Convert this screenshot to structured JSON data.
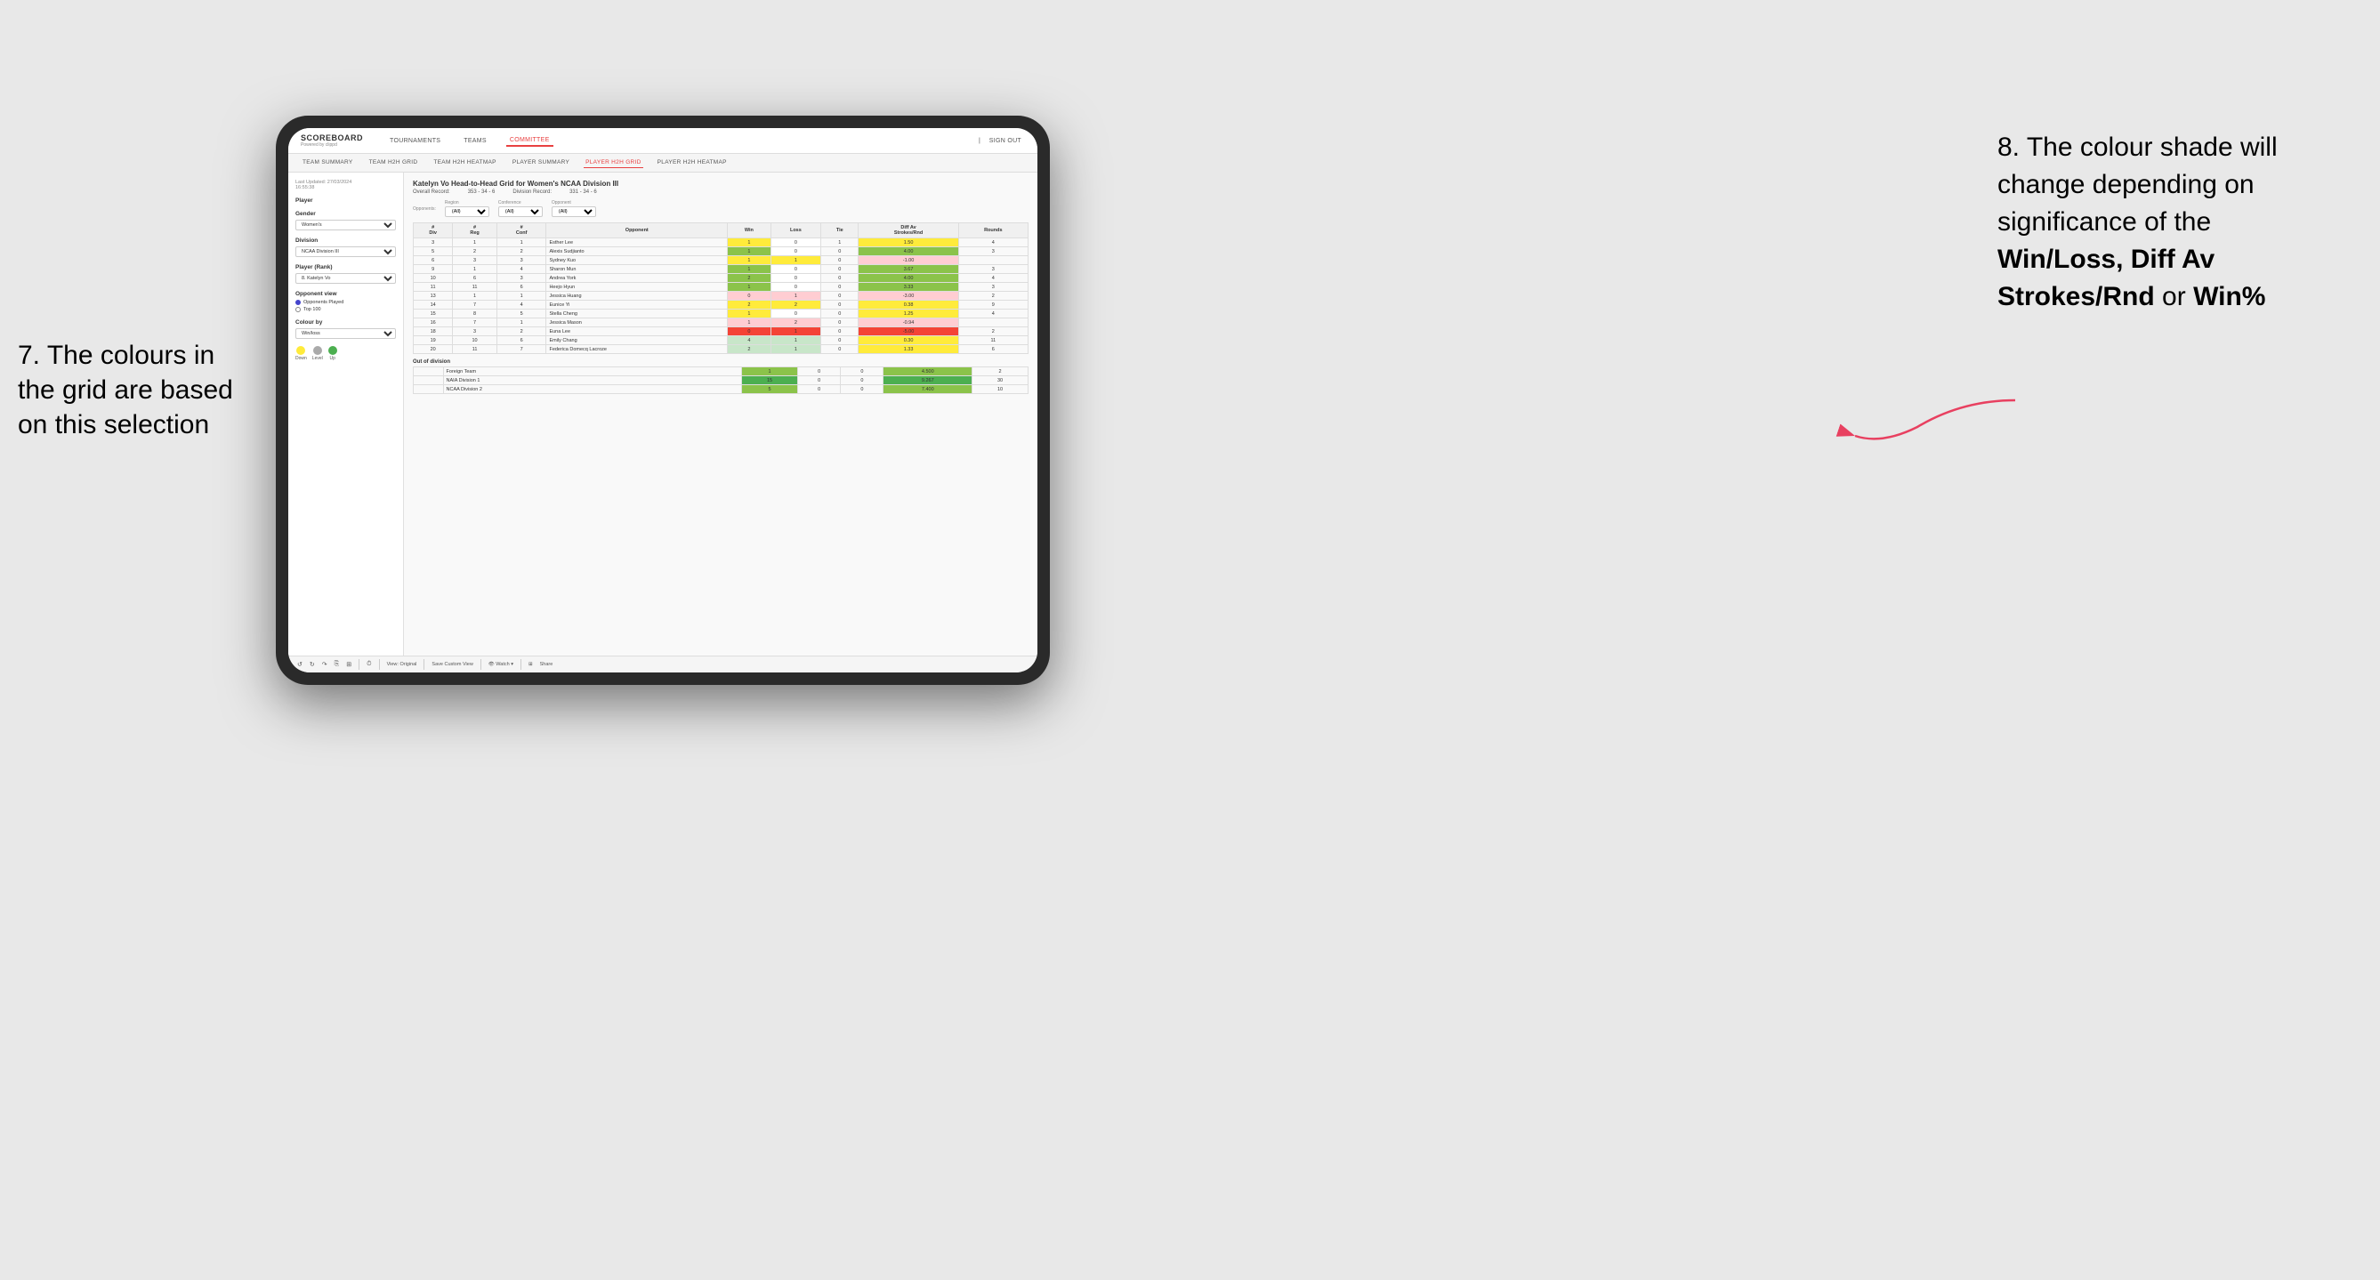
{
  "annotations": {
    "left_title": "7. The colours in the grid are based on this selection",
    "right_title": "8. The colour shade will change depending on significance of the",
    "right_bold1": "Win/Loss,",
    "right_bold2": "Diff Av Strokes/Rnd",
    "right_text2": "or",
    "right_bold3": "Win%"
  },
  "nav": {
    "logo": "SCOREBOARD",
    "logo_sub": "Powered by clippd",
    "items": [
      "TOURNAMENTS",
      "TEAMS",
      "COMMITTEE"
    ],
    "active": "COMMITTEE",
    "sign_out": "Sign out"
  },
  "sub_nav": {
    "items": [
      "TEAM SUMMARY",
      "TEAM H2H GRID",
      "TEAM H2H HEATMAP",
      "PLAYER SUMMARY",
      "PLAYER H2H GRID",
      "PLAYER H2H HEATMAP"
    ],
    "active": "PLAYER H2H GRID"
  },
  "sidebar": {
    "last_updated_label": "Last Updated: 27/03/2024",
    "last_updated_time": "16:55:38",
    "player_label": "Player",
    "gender_label": "Gender",
    "gender_value": "Women's",
    "division_label": "Division",
    "division_value": "NCAA Division III",
    "player_rank_label": "Player (Rank)",
    "player_rank_value": "8. Katelyn Vo",
    "opponent_view_label": "Opponent view",
    "radio1": "Opponents Played",
    "radio2": "Top 100",
    "colour_by_label": "Colour by",
    "colour_by_value": "Win/loss",
    "legend": {
      "down_label": "Down",
      "level_label": "Level",
      "up_label": "Up"
    }
  },
  "grid": {
    "title": "Katelyn Vo Head-to-Head Grid for Women's NCAA Division III",
    "overall_record_label": "Overall Record:",
    "overall_record": "353 - 34 - 6",
    "division_record_label": "Division Record:",
    "division_record": "331 - 34 - 6",
    "filter_opponents_label": "Opponents:",
    "filter_region_label": "Region",
    "filter_conference_label": "Conference",
    "filter_opponent_label": "Opponent",
    "filter_all": "(All)",
    "col_headers": [
      "#\nDiv",
      "#\nReg",
      "#\nConf",
      "Opponent",
      "Win",
      "Loss",
      "Tie",
      "Diff Av\nStrokes/Rnd",
      "Rounds"
    ],
    "rows": [
      {
        "div": "3",
        "reg": "1",
        "conf": "1",
        "opponent": "Esther Lee",
        "win": 1,
        "loss": 0,
        "tie": 1,
        "diff": "1.50",
        "rounds": 4,
        "win_color": "yellow",
        "diff_color": "yellow"
      },
      {
        "div": "5",
        "reg": "2",
        "conf": "2",
        "opponent": "Alexis Sudjianto",
        "win": 1,
        "loss": 0,
        "tie": 0,
        "diff": "4.00",
        "rounds": 3,
        "win_color": "green-med",
        "diff_color": "green-med"
      },
      {
        "div": "6",
        "reg": "3",
        "conf": "3",
        "opponent": "Sydney Kuo",
        "win": 1,
        "loss": 1,
        "tie": 0,
        "diff": "-1.00",
        "rounds": "",
        "win_color": "yellow",
        "diff_color": "red-light"
      },
      {
        "div": "9",
        "reg": "1",
        "conf": "4",
        "opponent": "Sharon Mun",
        "win": 1,
        "loss": 0,
        "tie": 0,
        "diff": "3.67",
        "rounds": 3,
        "win_color": "green-med",
        "diff_color": "green-med"
      },
      {
        "div": "10",
        "reg": "6",
        "conf": "3",
        "opponent": "Andrea York",
        "win": 2,
        "loss": 0,
        "tie": 0,
        "diff": "4.00",
        "rounds": 4,
        "win_color": "green-med",
        "diff_color": "green-med"
      },
      {
        "div": "11",
        "reg": "11",
        "conf": "6",
        "opponent": "Heejo Hyun",
        "win": 1,
        "loss": 0,
        "tie": 0,
        "diff": "3.33",
        "rounds": 3,
        "win_color": "green-med",
        "diff_color": "green-med"
      },
      {
        "div": "13",
        "reg": "1",
        "conf": "1",
        "opponent": "Jessica Huang",
        "win": 0,
        "loss": 1,
        "tie": 0,
        "diff": "-3.00",
        "rounds": 2,
        "win_color": "red-light",
        "diff_color": "red-light"
      },
      {
        "div": "14",
        "reg": "7",
        "conf": "4",
        "opponent": "Eunice Yi",
        "win": 2,
        "loss": 2,
        "tie": 0,
        "diff": "0.38",
        "rounds": 9,
        "win_color": "yellow",
        "diff_color": "yellow"
      },
      {
        "div": "15",
        "reg": "8",
        "conf": "5",
        "opponent": "Stella Cheng",
        "win": 1,
        "loss": 0,
        "tie": 0,
        "diff": "1.25",
        "rounds": 4,
        "win_color": "yellow",
        "diff_color": "yellow"
      },
      {
        "div": "16",
        "reg": "7",
        "conf": "1",
        "opponent": "Jessica Mason",
        "win": 1,
        "loss": 2,
        "tie": 0,
        "diff": "-0.94",
        "rounds": "",
        "win_color": "red-light",
        "diff_color": "red-light"
      },
      {
        "div": "18",
        "reg": "3",
        "conf": "2",
        "opponent": "Euna Lee",
        "win": 0,
        "loss": 1,
        "tie": 0,
        "diff": "-5.00",
        "rounds": 2,
        "win_color": "red-dark",
        "diff_color": "red-dark"
      },
      {
        "div": "19",
        "reg": "10",
        "conf": "6",
        "opponent": "Emily Chang",
        "win": 4,
        "loss": 1,
        "tie": 0,
        "diff": "0.30",
        "rounds": 11,
        "win_color": "green-light",
        "diff_color": "yellow"
      },
      {
        "div": "20",
        "reg": "11",
        "conf": "7",
        "opponent": "Federica Domecq Lacroze",
        "win": 2,
        "loss": 1,
        "tie": 0,
        "diff": "1.33",
        "rounds": 6,
        "win_color": "green-light",
        "diff_color": "yellow"
      }
    ],
    "out_of_division_label": "Out of division",
    "out_of_division_rows": [
      {
        "opponent": "Foreign Team",
        "win": 1,
        "loss": 0,
        "tie": 0,
        "diff": "4.500",
        "rounds": 2,
        "win_color": "green-med",
        "diff_color": "green-med"
      },
      {
        "opponent": "NAIA Division 1",
        "win": 15,
        "loss": 0,
        "tie": 0,
        "diff": "9.267",
        "rounds": 30,
        "win_color": "green-dark",
        "diff_color": "green-dark"
      },
      {
        "opponent": "NCAA Division 2",
        "win": 5,
        "loss": 0,
        "tie": 0,
        "diff": "7.400",
        "rounds": 10,
        "win_color": "green-med",
        "diff_color": "green-med"
      }
    ]
  },
  "toolbar": {
    "view_original": "View: Original",
    "save_custom": "Save Custom View",
    "watch": "Watch",
    "share": "Share"
  }
}
